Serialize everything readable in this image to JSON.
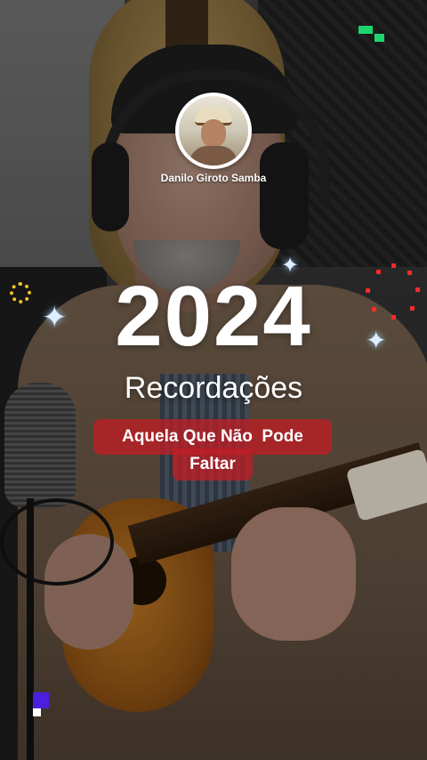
{
  "channel": {
    "name": "Danilo Giroto Samba"
  },
  "overlay": {
    "year": "2024",
    "subtitle": "Recordações",
    "tag_line1": "Aquela Que Não  Pode",
    "tag_line2": "Faltar"
  },
  "decorations": {
    "icons": [
      "sparkle-icon",
      "gold-ring-icon",
      "green-pixel-icon",
      "red-dot-ring-icon",
      "purple-pixel-icon"
    ],
    "colors": {
      "tag_background": "#be1e24",
      "sparkle": "#dfeeff",
      "pixel_green": "#1ed46e",
      "pixel_purple": "#4a1fe0",
      "dots_red": "#ff2b2b",
      "ring_gold": "#f2c521"
    }
  }
}
